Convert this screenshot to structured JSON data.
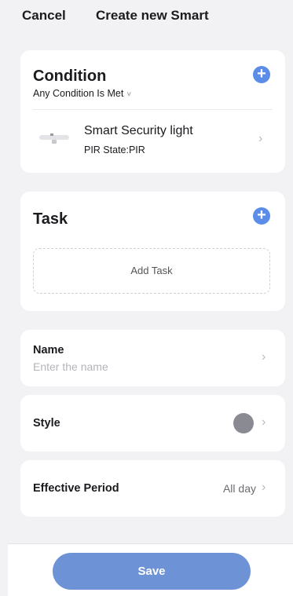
{
  "header": {
    "cancel_label": "Cancel",
    "title": "Create new Smart"
  },
  "condition": {
    "title": "Condition",
    "match_mode": "Any Condition Is Met",
    "match_mode_chevron": "˅",
    "add_icon": "plus-icon",
    "items": [
      {
        "device_name": "Smart Security light",
        "state": "PIR State:PIR",
        "icon": "light-fixture-icon"
      }
    ]
  },
  "task": {
    "title": "Task",
    "add_task_label": "Add Task",
    "add_icon": "plus-icon"
  },
  "name": {
    "label": "Name",
    "placeholder": "Enter the name"
  },
  "style": {
    "label": "Style",
    "color": "#8a8b92"
  },
  "effective_period": {
    "label": "Effective Period",
    "value": "All day"
  },
  "row_chevron": "›",
  "save_label": "Save",
  "colors": {
    "accent": "#5a8ce8",
    "save_button": "#6e92d6",
    "background": "#f2f2f4"
  }
}
